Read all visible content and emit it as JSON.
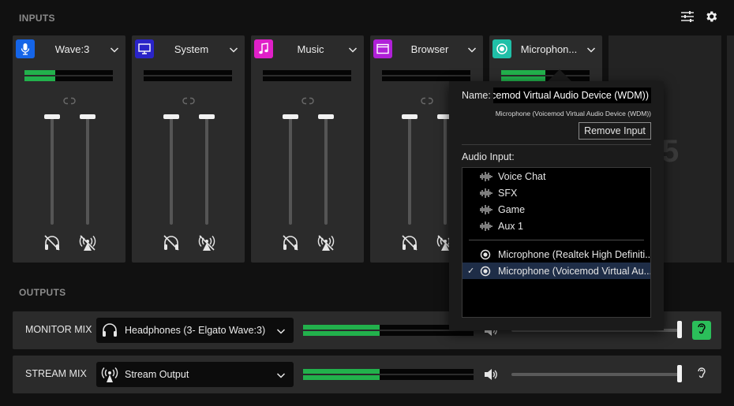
{
  "sections": {
    "inputs_title": "INPUTS",
    "outputs_title": "OUTPUTS"
  },
  "toolbar": {
    "mixer_settings_icon": "sliders-icon",
    "settings_icon": "gear-icon"
  },
  "channels": [
    {
      "name": "Wave:3",
      "icon": "microphone-icon",
      "color": "#1565e8",
      "meter_level": 0.35
    },
    {
      "name": "System",
      "icon": "monitor-icon",
      "color": "#2a24c8",
      "meter_level": 0
    },
    {
      "name": "Music",
      "icon": "music-note-icon",
      "color": "#e020c8",
      "meter_level": 0
    },
    {
      "name": "Browser",
      "icon": "browser-window-icon",
      "color": "#b020d8",
      "meter_level": 0
    },
    {
      "name": "Microphone (Voicemod Virtual Audio Device (WDM))",
      "display_name": "Microphon...",
      "icon": "record-icon",
      "color": "#20c0a8",
      "meter_level": 0.5
    }
  ],
  "popup": {
    "name_label": "Name:",
    "name_value": "Voicemod Virtual Audio Device (WDM))",
    "device_subtitle": "Microphone (Voicemod Virtual Audio Device (WDM))",
    "remove_button": "Remove Input",
    "audio_input_label": "Audio Input:",
    "virtual_inputs": [
      "Voice Chat",
      "SFX",
      "Game",
      "Aux 1"
    ],
    "devices": [
      "Microphone (Realtek High Definiti...",
      "Microphone (Voicemod Virtual Au..."
    ],
    "selected_device_index": 1
  },
  "outputs": [
    {
      "label": "MONITOR MIX",
      "device": "Headphones (3- Elgato Wave:3)",
      "device_icon": "headphones-icon",
      "meter_level": 0.45,
      "volume": 1.0,
      "listen_active": true
    },
    {
      "label": "STREAM MIX",
      "device": "Stream Output",
      "device_icon": "broadcast-icon",
      "meter_level": 0.45,
      "volume": 1.0,
      "listen_active": false
    }
  ],
  "colors": {
    "meter_green": "#22b14c",
    "listen_active": "#2bbf5a"
  }
}
